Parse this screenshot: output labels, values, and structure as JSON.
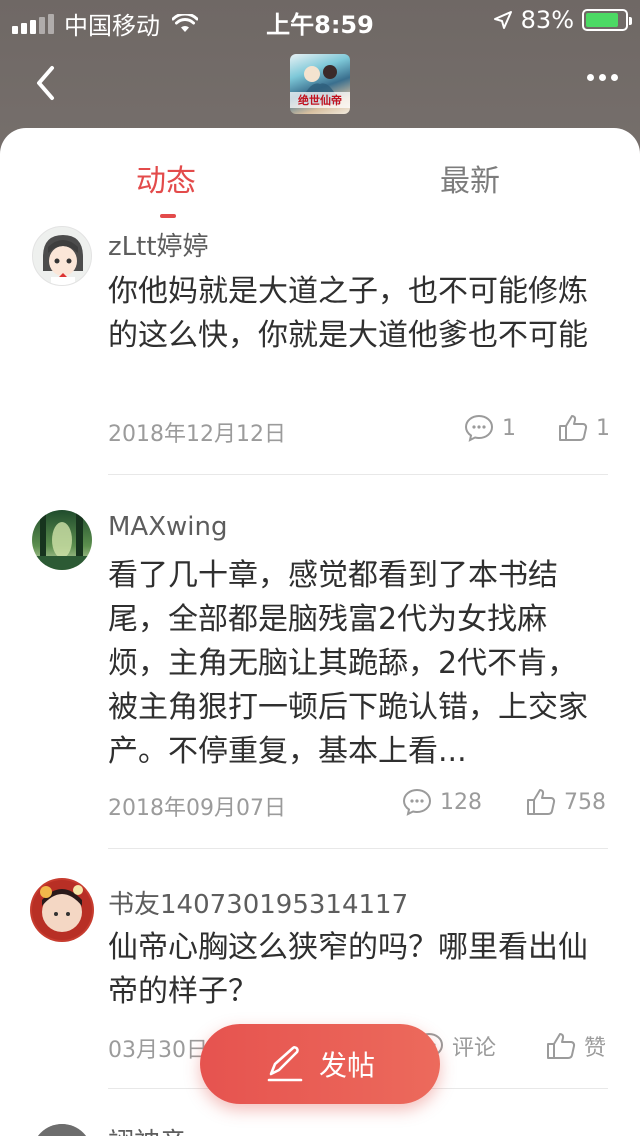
{
  "status_bar": {
    "carrier": "中国移动",
    "time": "上午8:59",
    "battery_percent_text": "83%",
    "battery_level": 0.83
  },
  "nav": {
    "book_cover_title": "绝世仙帝"
  },
  "tabs": [
    {
      "label": "动态",
      "active": true
    },
    {
      "label": "最新",
      "active": false
    }
  ],
  "posts": [
    {
      "username": "zLtt婷婷",
      "content": "你他妈就是大道之子，也不可能修炼的这么快，你就是大道他爹也不可能",
      "date": "2018年12月12日",
      "comment_count": "1",
      "like_count": "1"
    },
    {
      "username": "MAXwing",
      "content": "看了几十章，感觉都看到了本书结尾，全部都是脑残富2代为女找麻烦，主角无脑让其跪舔，2代不肯，被主角狠打一顿后下跪认错，上交家产。不停重复，基本上看...",
      "date": "2018年09月07日",
      "comment_count": "128",
      "like_count": "758"
    },
    {
      "username": "书友140730195314117",
      "content": "仙帝心胸这么狭窄的吗？哪里看出仙帝的样子？",
      "date": "03月30日",
      "comment_count": "评论",
      "like_count": "赞"
    },
    {
      "username": "翊神音"
    }
  ],
  "fab": {
    "label": "发帖"
  },
  "colors": {
    "accent": "#e34b4b",
    "battery": "#4cd964"
  }
}
